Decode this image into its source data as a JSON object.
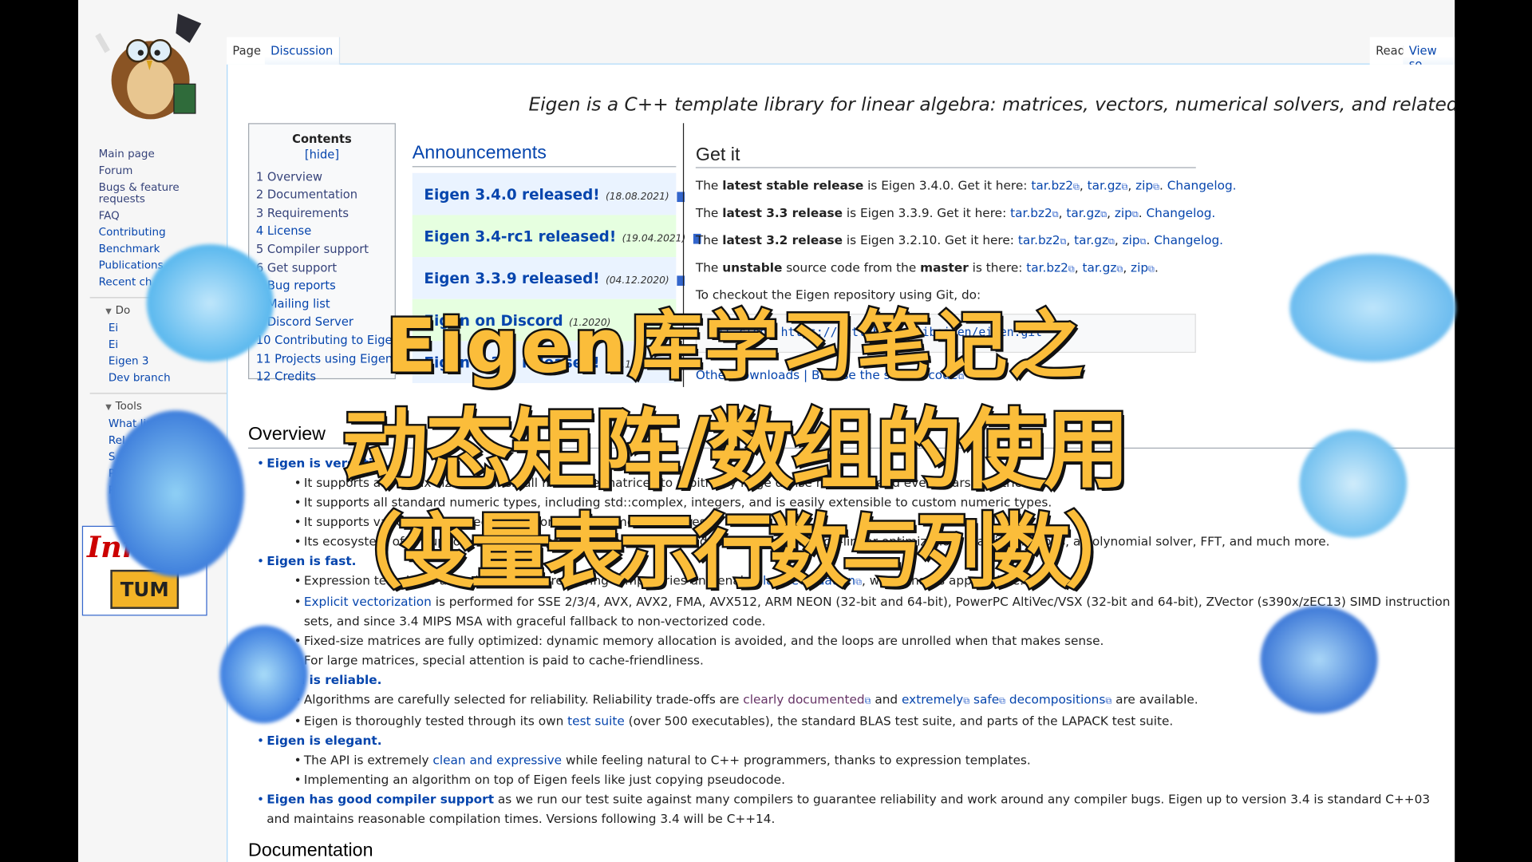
{
  "sidebar": {
    "nav": [
      {
        "label": "Main page"
      },
      {
        "label": "Forum"
      },
      {
        "label": "Bugs & feature requests"
      },
      {
        "label": "FAQ"
      },
      {
        "label": "Contributing"
      },
      {
        "label": "Benchmark"
      },
      {
        "label": "Publications"
      },
      {
        "label": "Recent ch"
      }
    ],
    "docs_heading": "Do",
    "docs_items": [
      {
        "label": "Ei"
      },
      {
        "label": "Ei"
      },
      {
        "label": "Eigen 3"
      },
      {
        "label": "Dev branch"
      }
    ],
    "tools_heading": "Tools",
    "tools_items": [
      {
        "label": "What links here"
      },
      {
        "label": "Rel"
      },
      {
        "label": "S"
      },
      {
        "label": "Pr"
      },
      {
        "label": "Pe"
      }
    ],
    "sponsor1": "Inria",
    "sponsor2": "TUM"
  },
  "tabs": {
    "page": "Page",
    "discussion": "Discussion",
    "read": "Read",
    "view_source": "View so"
  },
  "tagline": "Eigen is a C++ template library for linear algebra: matrices, vectors, numerical solvers, and related algorithms.",
  "toc": {
    "title": "Contents",
    "hide": "[hide]",
    "items": [
      "1 Overview",
      "2 Documentation",
      "3 Requirements",
      "4 License",
      "5 Compiler support",
      "6 Get support",
      "7 Bug reports",
      "8 Mailing list",
      "9 Discord Server",
      "10 Contributing to Eigen",
      "11 Projects using Eigen",
      "12 Credits"
    ]
  },
  "announcements": {
    "heading": "Announcements",
    "items": [
      {
        "title": "Eigen 3.4.0 released!",
        "date": "(18.08.2021)"
      },
      {
        "title": "Eigen 3.4-rc1 released!",
        "date": "(19.04.2021)"
      },
      {
        "title": "Eigen 3.3.9 released!",
        "date": "(04.12.2020)"
      },
      {
        "title": "Eigen on Discord",
        "date": "(1.2020)"
      },
      {
        "title": "Eigen 3.3.8 released!",
        "date": "(05.10.2020)"
      }
    ]
  },
  "getit": {
    "heading": "Get it",
    "rows": [
      {
        "pre": "The ",
        "bold": "latest stable release",
        "mid": " is Eigen 3.4.0. Get it here: ",
        "changelog": "Changelog."
      },
      {
        "pre": "The ",
        "bold": "latest 3.3 release",
        "mid": " is Eigen 3.3.9. Get it here: ",
        "changelog": "Changelog."
      },
      {
        "pre": "The ",
        "bold": "latest 3.2 release",
        "mid": " is Eigen 3.2.10. Get it here: ",
        "changelog": "Changelog."
      }
    ],
    "unstable": {
      "pre": "The ",
      "b1": "unstable",
      "mid": " source code from the ",
      "b2": "master",
      "post": " is there: "
    },
    "links": {
      "bz2": "tar.bz2",
      "gz": "tar.gz",
      "zip": "zip"
    },
    "checkout": "To checkout the Eigen repository using Git, do:",
    "code": "git clone https://gitlab.com/libeigen/eigen.git",
    "other": "Other downloads | Browse the source code"
  },
  "overview": {
    "heading": "Overview",
    "versatile": "Eigen is versatile.",
    "versatile_items": [
      "It supports all matrix sizes, from small fixed-size matrices to arbitrarily large dense matrices, and even sparse matrices.",
      "It supports all standard numeric types, including std::complex, integers, and is easily extensible to custom numeric types.",
      "It supports various matrix decompositions and geometry features.",
      "Its ecosystem of unsupported modules provides many specialized features such as non-linear optimization, matrix functions, a polynomial solver, FFT, and much more."
    ],
    "fast": "Eigen is fast.",
    "fast_items": {
      "expr_pre": "Expression templates allow intelligently removing temporaries and enable ",
      "expr_link": "lazy evaluation",
      "expr_post": ", when that is appropriate.",
      "vec_link": "Explicit vectorization",
      "vec_post": " is performed for SSE 2/3/4, AVX, AVX2, FMA, AVX512, ARM NEON (32-bit and 64-bit), PowerPC AltiVec/VSX (32-bit and 64-bit), ZVector (s390x/zEC13) SIMD instruction sets, and since 3.4 MIPS MSA with graceful fallback to non-vectorized code.",
      "fixed": "Fixed-size matrices are fully optimized: dynamic memory allocation is avoided, and the loops are unrolled when that makes sense.",
      "large": "For large matrices, special attention is paid to cache-friendliness."
    },
    "reliable": "Eigen is reliable.",
    "reliable_items": {
      "alg_pre": "Algorithms are carefully selected for reliability. Reliability trade-offs are ",
      "alg_l1": "clearly documented",
      "alg_and": " and ",
      "alg_l2": "extremely",
      "alg_l3": "safe",
      "alg_l4": "decompositions",
      "alg_post": " are available.",
      "test_pre": "Eigen is thoroughly tested through its own ",
      "test_link": "test suite",
      "test_post": " (over 500 executables), the standard BLAS test suite, and parts of the LAPACK test suite."
    },
    "elegant": "Eigen is elegant.",
    "elegant_items": {
      "api_pre": "The API is extremely ",
      "api_link": "clean and expressive",
      "api_post": " while feeling natural to C++ programmers, thanks to expression templates.",
      "impl": "Implementing an algorithm on top of Eigen feels like just copying pseudocode."
    },
    "compiler_bold": "Eigen has good compiler support",
    "compiler_post": " as we run our test suite against many compilers to guarantee reliability and work around any compiler bugs. Eigen up to version 3.4 is standard C++03 and maintains reasonable compilation times. Versions following 3.4 will be C++14."
  },
  "documentation_heading": "Documentation",
  "overlay_title": {
    "line1": "Eigen库学习笔记之",
    "line2": "动态矩阵/数组的使用",
    "line3": "（变量表示行数与列数）",
    "fill_color": "#fbbd3a",
    "stroke_color": "#111111"
  }
}
